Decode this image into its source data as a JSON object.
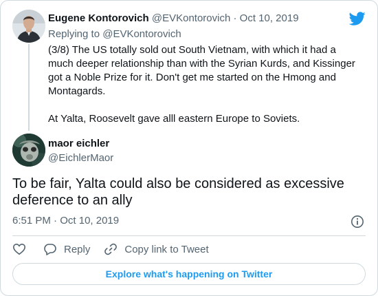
{
  "reply_tweet": {
    "name": "Eugene Kontorovich",
    "handle": "@EVKontorovich",
    "separator": "·",
    "date": "Oct 10, 2019",
    "replying_label": "Replying to",
    "replying_to": "@EVKontorovich",
    "paragraphs": [
      "(3/8) The US totally sold out South Vietnam, with which it had a much deeper relationship than with the Syrian Kurds, and Kissinger got a Noble Prize for it. Don't get me started on the Hmong and Montagards.",
      "At Yalta, Roosevelt gave alll eastern Europe to Soviets."
    ]
  },
  "main_tweet": {
    "name": "maor eichler",
    "handle": "@EichlerMaor",
    "text": "To be fair, Yalta could also be considered as excessive deference to an ally",
    "time": "6:51 PM",
    "separator": "·",
    "date": "Oct 10, 2019"
  },
  "actions": {
    "reply_label": "Reply",
    "copy_link_label": "Copy link to Tweet"
  },
  "explore_label": "Explore what's happening on Twitter",
  "colors": {
    "accent": "#1d9bf0",
    "text": "#0f1419",
    "muted": "#536471",
    "border": "#cfd9de"
  },
  "icons": [
    "twitter-bird-icon",
    "info-icon",
    "heart-icon",
    "reply-icon",
    "link-icon"
  ]
}
